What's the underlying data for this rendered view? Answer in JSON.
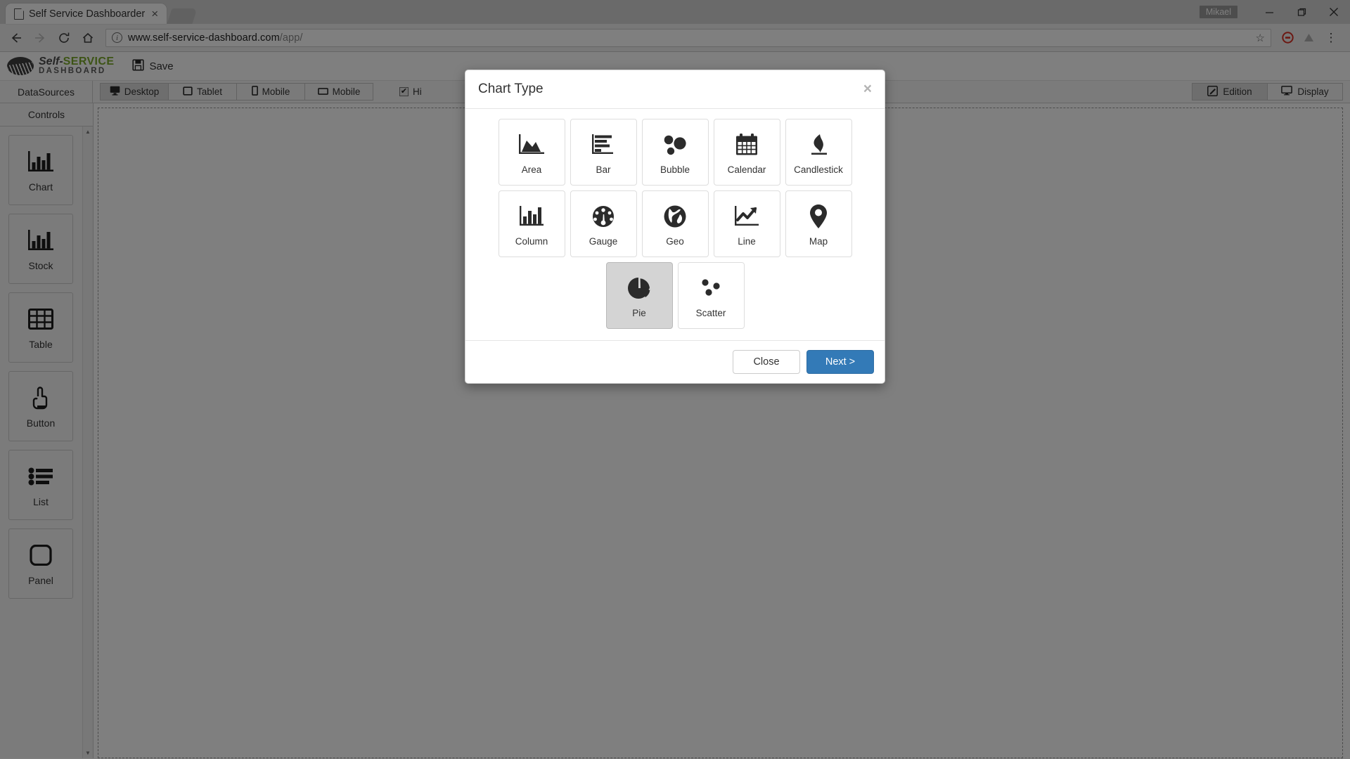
{
  "browser": {
    "tab_title": "Self Service Dashboarder",
    "tab_close_glyph": "×",
    "url_host": "www.self-service-dashboard.com",
    "url_path": "/app/",
    "star_glyph": "☆",
    "menu_glyph": "⋮",
    "user_label": "Mikael",
    "minimize_glyph": "—",
    "maximize_glyph": "❐",
    "close_glyph": "✕"
  },
  "app": {
    "logo_line1_a": "Self-",
    "logo_line1_b": "SERVICE",
    "logo_line2": "DASHBOARD",
    "save_label": "Save"
  },
  "toolbar": {
    "datasources_label": "DataSources",
    "device_tabs": [
      {
        "label": "Desktop",
        "icon": "desktop-icon",
        "active": true
      },
      {
        "label": "Tablet",
        "icon": "tablet-icon",
        "active": false
      },
      {
        "label": "Mobile",
        "icon": "mobile-portrait-icon",
        "active": false
      },
      {
        "label": "Mobile",
        "icon": "mobile-landscape-icon",
        "active": false
      }
    ],
    "checkbox_label": "Hi",
    "checkbox_checked": true,
    "checkbox_glyph": "✔",
    "mode_tabs": [
      {
        "label": "Edition",
        "icon": "edit-icon",
        "active": true
      },
      {
        "label": "Display",
        "icon": "monitor-icon",
        "active": false
      }
    ]
  },
  "sidebar": {
    "title": "Controls",
    "scroll_up_glyph": "▲",
    "scroll_down_glyph": "▼",
    "items": [
      {
        "label": "Chart",
        "icon": "bar-chart-icon"
      },
      {
        "label": "Stock",
        "icon": "bar-chart-icon"
      },
      {
        "label": "Table",
        "icon": "table-grid-icon"
      },
      {
        "label": "Button",
        "icon": "pointing-hand-icon"
      },
      {
        "label": "List",
        "icon": "bullet-list-icon"
      },
      {
        "label": "Panel",
        "icon": "rounded-square-icon"
      }
    ]
  },
  "modal": {
    "title": "Chart Type",
    "close_glyph": "×",
    "chart_types": [
      {
        "label": "Area",
        "icon": "area-chart-icon",
        "selected": false
      },
      {
        "label": "Bar",
        "icon": "bar-horizontal-icon",
        "selected": false
      },
      {
        "label": "Bubble",
        "icon": "bubble-chart-icon",
        "selected": false
      },
      {
        "label": "Calendar",
        "icon": "calendar-icon",
        "selected": false
      },
      {
        "label": "Candlestick",
        "icon": "candlestick-icon",
        "selected": false
      },
      {
        "label": "Column",
        "icon": "column-chart-icon",
        "selected": false
      },
      {
        "label": "Gauge",
        "icon": "gauge-icon",
        "selected": false
      },
      {
        "label": "Geo",
        "icon": "globe-icon",
        "selected": false
      },
      {
        "label": "Line",
        "icon": "line-chart-icon",
        "selected": false
      },
      {
        "label": "Map",
        "icon": "map-pin-icon",
        "selected": false
      },
      {
        "label": "Pie",
        "icon": "pie-chart-icon",
        "selected": true
      },
      {
        "label": "Scatter",
        "icon": "scatter-plot-icon",
        "selected": false
      }
    ],
    "close_button": "Close",
    "next_button": "Next >"
  },
  "colors": {
    "primary": "#337ab7",
    "accent_green": "#7aa82b",
    "overlay": "#808080",
    "selected_tile": "#d4d4d4"
  }
}
